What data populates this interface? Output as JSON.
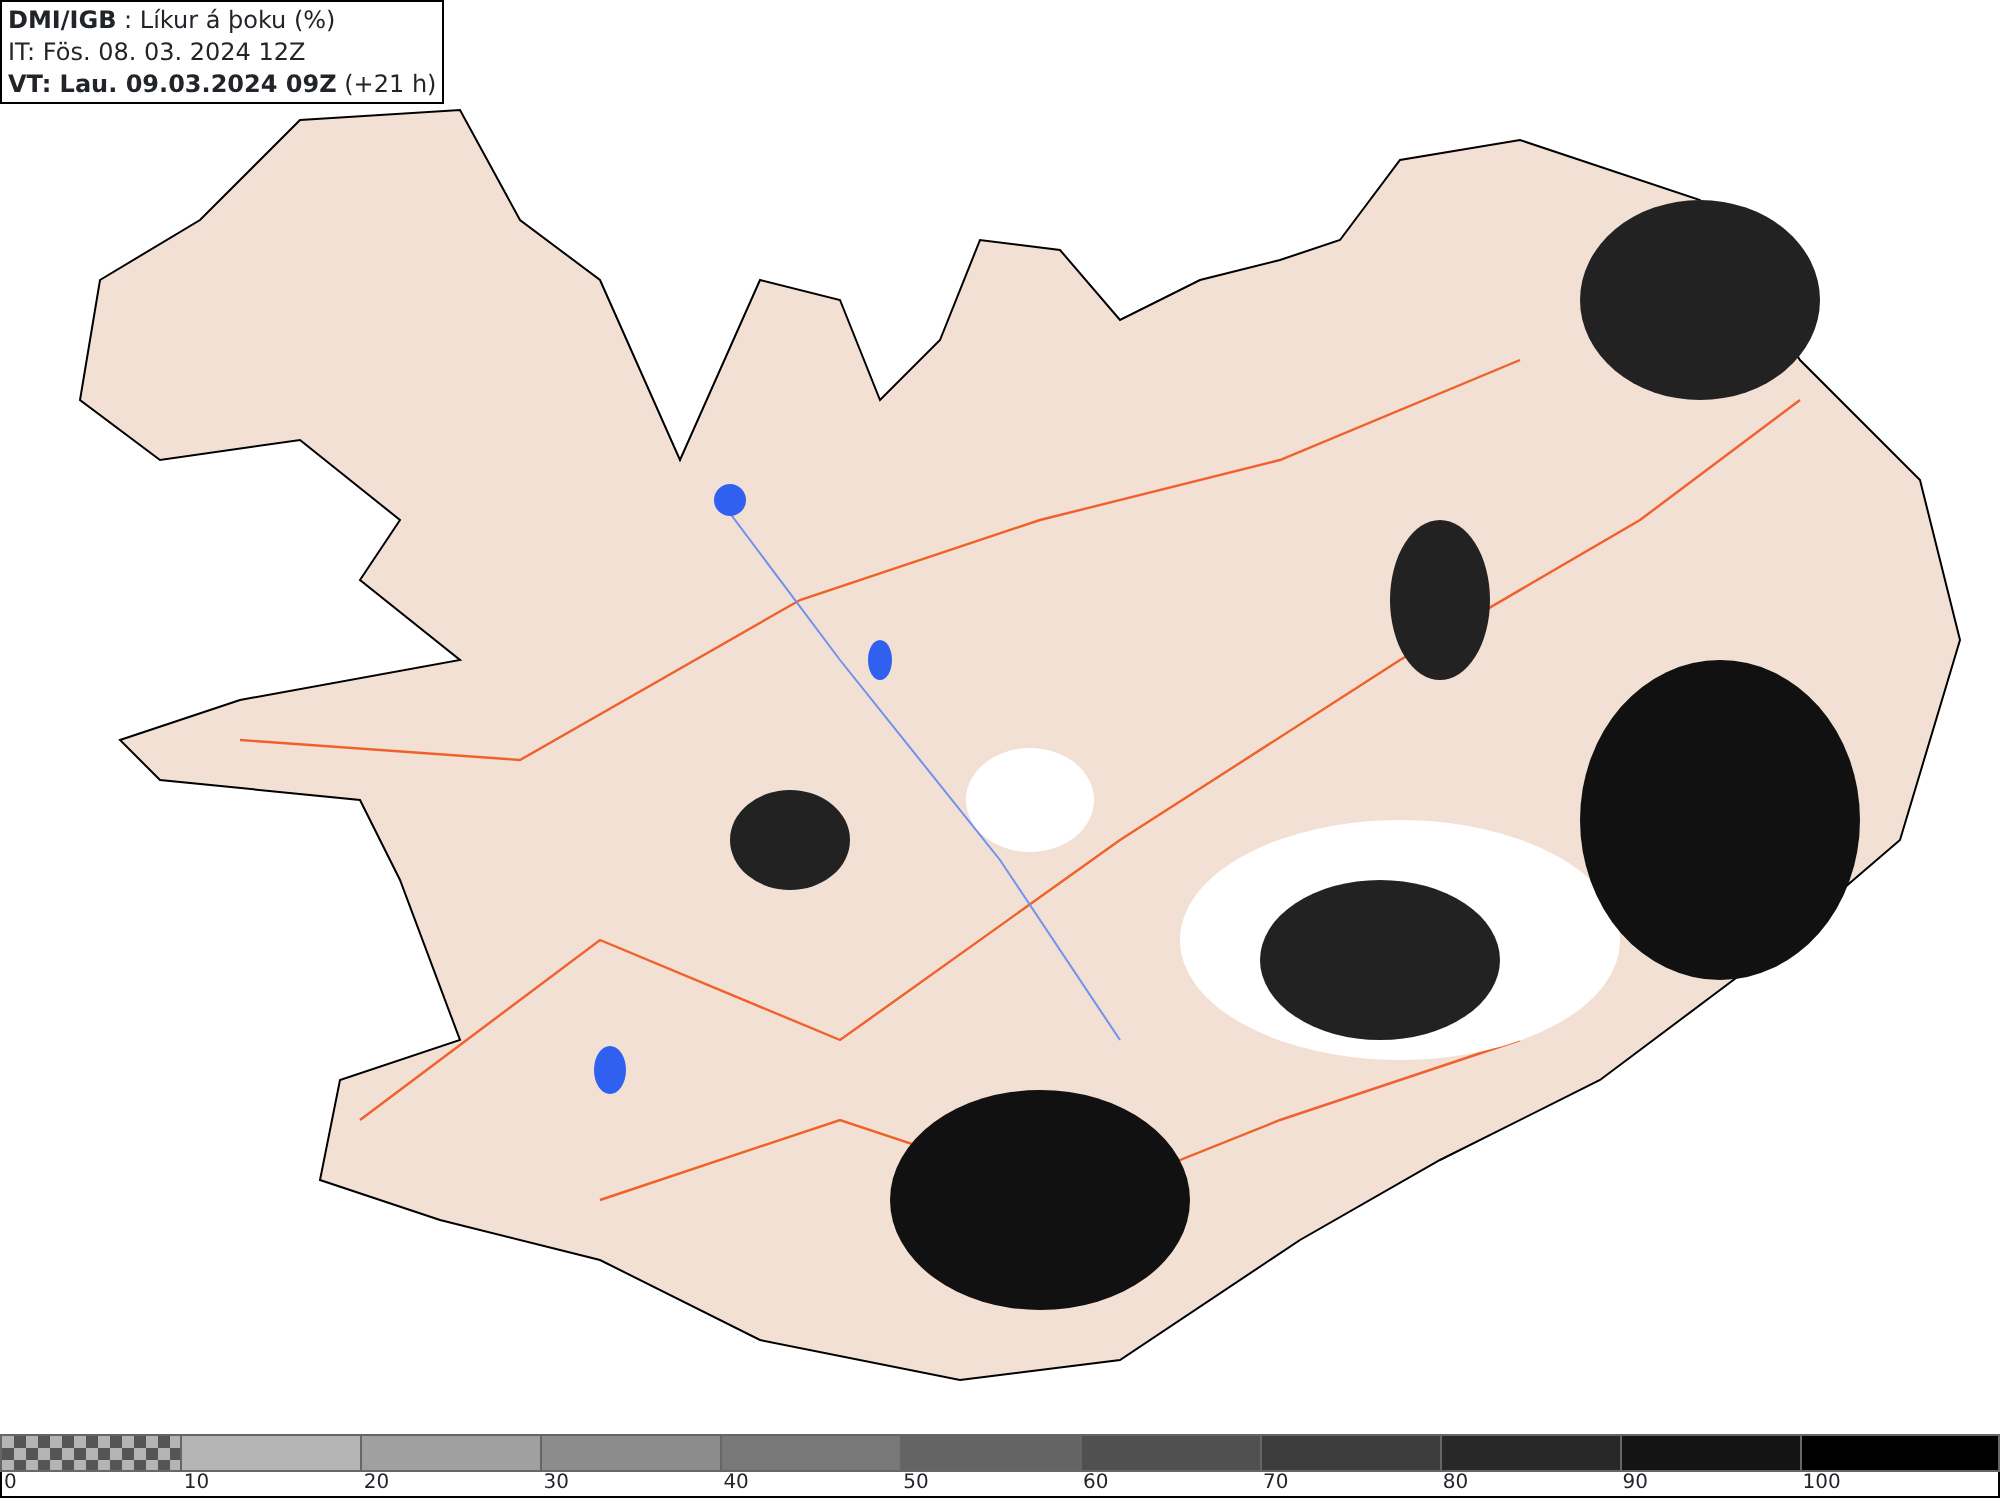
{
  "header": {
    "lines": [
      "**DMI/IGB** : Líkur á þoku (%)",
      "IT: Fös. 08. 03. 2024 12Z",
      "**VT: Lau. 09.03.2024 09Z** (+21 h)"
    ]
  },
  "legend": {
    "segments": [
      {
        "kind": "checker"
      },
      {
        "kind": "solid",
        "color": "#b4b4b4"
      },
      {
        "kind": "solid",
        "color": "#a0a0a0"
      },
      {
        "kind": "solid",
        "color": "#8c8c8c"
      },
      {
        "kind": "solid",
        "color": "#787878"
      },
      {
        "kind": "solid",
        "color": "#646464"
      },
      {
        "kind": "solid",
        "color": "#505050"
      },
      {
        "kind": "solid",
        "color": "#3c3c3c"
      },
      {
        "kind": "solid",
        "color": "#282828"
      },
      {
        "kind": "solid",
        "color": "#141414"
      },
      {
        "kind": "solid",
        "color": "#000000"
      }
    ],
    "labels": [
      "0",
      "10",
      "20",
      "30",
      "40",
      "50",
      "60",
      "70",
      "80",
      "90",
      "100"
    ]
  }
}
